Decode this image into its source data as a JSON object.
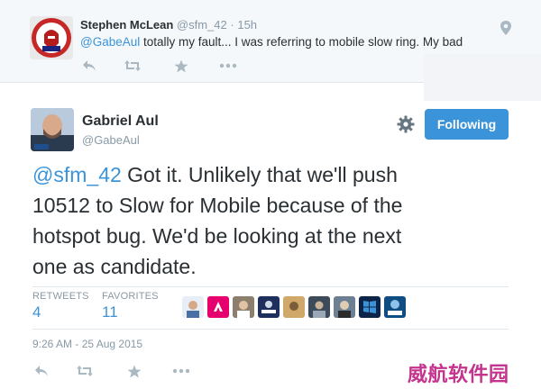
{
  "reply_tweet": {
    "name": "Stephen McLean",
    "handle": "@sfm_42",
    "separator": "·",
    "time": "15h",
    "mention": "@GabeAul",
    "text": " totally my fault... I was referring to mobile slow ring. My bad",
    "actions": [
      "reply-icon",
      "retweet-icon",
      "favorite-icon",
      "more-icon"
    ]
  },
  "main_tweet": {
    "name": "Gabriel Aul",
    "handle": "@GabeAul",
    "follow_label": "Following",
    "mention": "@sfm_42",
    "text_lines": [
      " Got it. Unlikely that we'll push",
      "10512 to Slow for Mobile because of the",
      "hotspot bug. We'd be looking at the next",
      "one as candidate."
    ],
    "retweets_label": "RETWEETS",
    "retweets": "4",
    "favorites_label": "FAVORITES",
    "favorites": "11",
    "favorited_by_count": 9,
    "timestamp": "9:26 AM - 25 Aug 2015",
    "actions": [
      "reply-icon",
      "retweet-icon",
      "favorite-icon",
      "more-icon"
    ]
  },
  "colors": {
    "accent": "#3b94d9",
    "muted": "#8899a6",
    "icon": "#aab8c2",
    "watermark": "#c4338e"
  },
  "watermark": "威航软件园"
}
